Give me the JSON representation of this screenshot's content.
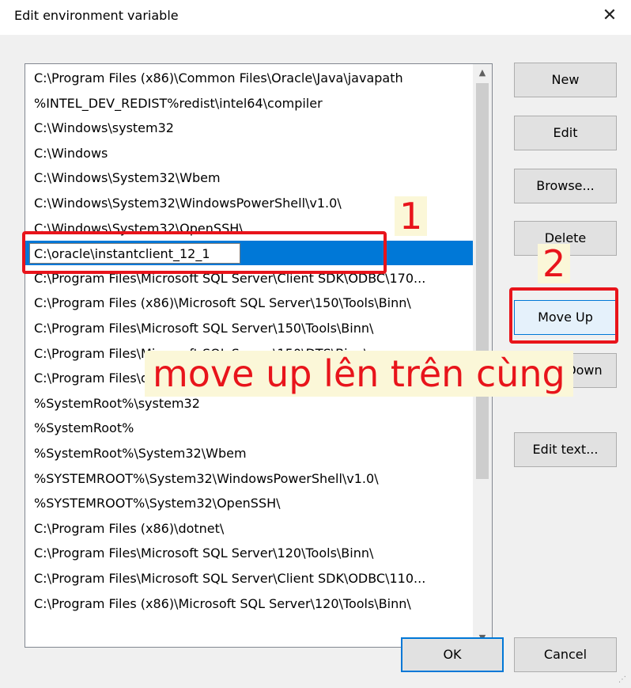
{
  "window": {
    "title": "Edit environment variable",
    "close_glyph": "✕"
  },
  "list": {
    "items": [
      "C:\\Program Files (x86)\\Common Files\\Oracle\\Java\\javapath",
      "%INTEL_DEV_REDIST%redist\\intel64\\compiler",
      "C:\\Windows\\system32",
      "C:\\Windows",
      "C:\\Windows\\System32\\Wbem",
      "C:\\Windows\\System32\\WindowsPowerShell\\v1.0\\",
      "C:\\Windows\\System32\\OpenSSH\\",
      "",
      "C:\\Program Files\\Microsoft SQL Server\\Client SDK\\ODBC\\170...",
      "C:\\Program Files (x86)\\Microsoft SQL Server\\150\\Tools\\Binn\\",
      "C:\\Program Files\\Microsoft SQL Server\\150\\Tools\\Binn\\",
      "C:\\Program Files\\Microsoft SQL Server\\150\\DTS\\Binn\\",
      "C:\\Program Files\\dotnet\\",
      "%SystemRoot%\\system32",
      "%SystemRoot%",
      "%SystemRoot%\\System32\\Wbem",
      "%SYSTEMROOT%\\System32\\WindowsPowerShell\\v1.0\\",
      "%SYSTEMROOT%\\System32\\OpenSSH\\",
      "C:\\Program Files (x86)\\dotnet\\",
      "C:\\Program Files\\Microsoft SQL Server\\120\\Tools\\Binn\\",
      "C:\\Program Files\\Microsoft SQL Server\\Client SDK\\ODBC\\110...",
      "C:\\Program Files (x86)\\Microsoft SQL Server\\120\\Tools\\Binn\\"
    ],
    "selected_index": 7,
    "editing_value": "C:\\oracle\\instantclient_12_1",
    "scroll_up_glyph": "▲",
    "scroll_down_glyph": "▼"
  },
  "buttons": {
    "new": "New",
    "edit": "Edit",
    "browse": "Browse...",
    "delete": "Delete",
    "move_up": "Move Up",
    "move_down": "Move Down",
    "edit_text": "Edit text...",
    "ok": "OK",
    "cancel": "Cancel"
  },
  "annotations": {
    "step1": "1",
    "step2": "2",
    "caption": "move up lên trên cùng",
    "color": "#e8141b",
    "highlight": "#fbf7d8"
  },
  "colors": {
    "selection": "#0078d7",
    "dialog_bg": "#f0f0f0"
  }
}
